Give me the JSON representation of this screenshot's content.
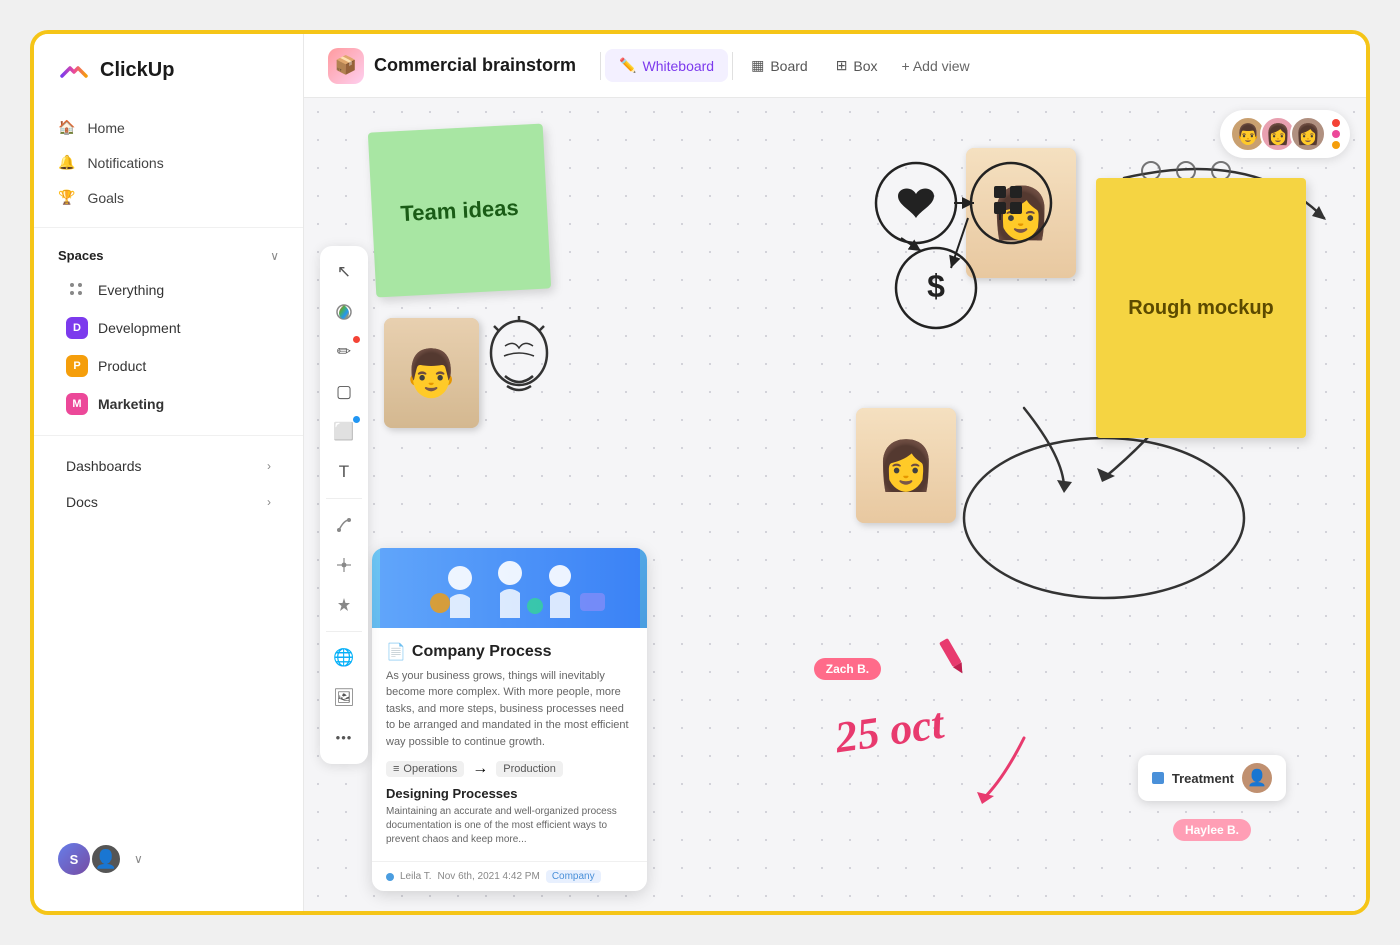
{
  "app": {
    "name": "ClickUp"
  },
  "sidebar": {
    "logo": "ClickUp",
    "nav": [
      {
        "id": "home",
        "label": "Home",
        "icon": "🏠"
      },
      {
        "id": "notifications",
        "label": "Notifications",
        "icon": "🔔"
      },
      {
        "id": "goals",
        "label": "Goals",
        "icon": "🏆"
      }
    ],
    "spaces_label": "Spaces",
    "spaces": [
      {
        "id": "everything",
        "label": "Everything",
        "color": "none"
      },
      {
        "id": "development",
        "label": "Development",
        "color": "#7c3aed",
        "initial": "D"
      },
      {
        "id": "product",
        "label": "Product",
        "color": "#f59e0b",
        "initial": "P"
      },
      {
        "id": "marketing",
        "label": "Marketing",
        "color": "#ec4899",
        "initial": "M",
        "bold": true
      }
    ],
    "dashboards_label": "Dashboards",
    "docs_label": "Docs",
    "user_initials": "S"
  },
  "topbar": {
    "doc_icon": "📦",
    "title": "Commercial brainstorm",
    "views": [
      {
        "id": "whiteboard",
        "label": "Whiteboard",
        "icon": "✏️",
        "active": true
      },
      {
        "id": "board",
        "label": "Board",
        "icon": "▦"
      },
      {
        "id": "box",
        "label": "Box",
        "icon": "⊞"
      }
    ],
    "add_view_label": "+ Add view"
  },
  "toolbar": {
    "tools": [
      {
        "id": "cursor",
        "icon": "↖",
        "dot": null
      },
      {
        "id": "palette",
        "icon": "🎨",
        "dot": null
      },
      {
        "id": "pencil",
        "icon": "✏",
        "dot": "red"
      },
      {
        "id": "square",
        "icon": "▢",
        "dot": null
      },
      {
        "id": "sticky",
        "icon": "⬜",
        "dot": "blue"
      },
      {
        "id": "text",
        "icon": "T",
        "dot": null
      },
      {
        "id": "connector",
        "icon": "↗",
        "dot": null
      },
      {
        "id": "mind-map",
        "icon": "⬡",
        "dot": null
      },
      {
        "id": "ai",
        "icon": "✦",
        "dot": null
      },
      {
        "id": "globe",
        "icon": "🌐",
        "dot": null
      },
      {
        "id": "image",
        "icon": "🖼",
        "dot": null
      },
      {
        "id": "more",
        "icon": "•••",
        "dot": null
      }
    ]
  },
  "whiteboard": {
    "sticky_green_text": "Team ideas",
    "sticky_yellow_text": "Rough mockup",
    "doc_title": "Company Process",
    "doc_text": "As your business grows, things will inevitably become more complex. With more people, more tasks, and more steps, business processes need to be arranged and mandated in the most efficient way possible to continue growth.",
    "doc_tags": [
      "Operations",
      "→",
      "Production"
    ],
    "doc_section_title": "Designing Processes",
    "doc_section_text": "Maintaining an accurate and well-organized process documentation is one of the most efficient ways to prevent chaos and keep more...",
    "doc_author": "Leila T.",
    "doc_date": "Nov 6th, 2021  4:42 PM",
    "doc_label": "Company",
    "date_annotation": "25 oct",
    "person_labels": [
      {
        "id": "zach",
        "label": "Zach B.",
        "color": "#ff6b8a"
      },
      {
        "id": "haylee",
        "label": "Haylee B.",
        "color": "#ff9eb5"
      }
    ],
    "treatment_label": "Treatment",
    "collaborators": [
      {
        "id": "c1",
        "bg": "#c9a96e",
        "icon": "👨"
      },
      {
        "id": "c2",
        "bg": "#e9a0b0",
        "icon": "👩"
      },
      {
        "id": "c3",
        "bg": "#b09080",
        "icon": "👩"
      }
    ]
  }
}
